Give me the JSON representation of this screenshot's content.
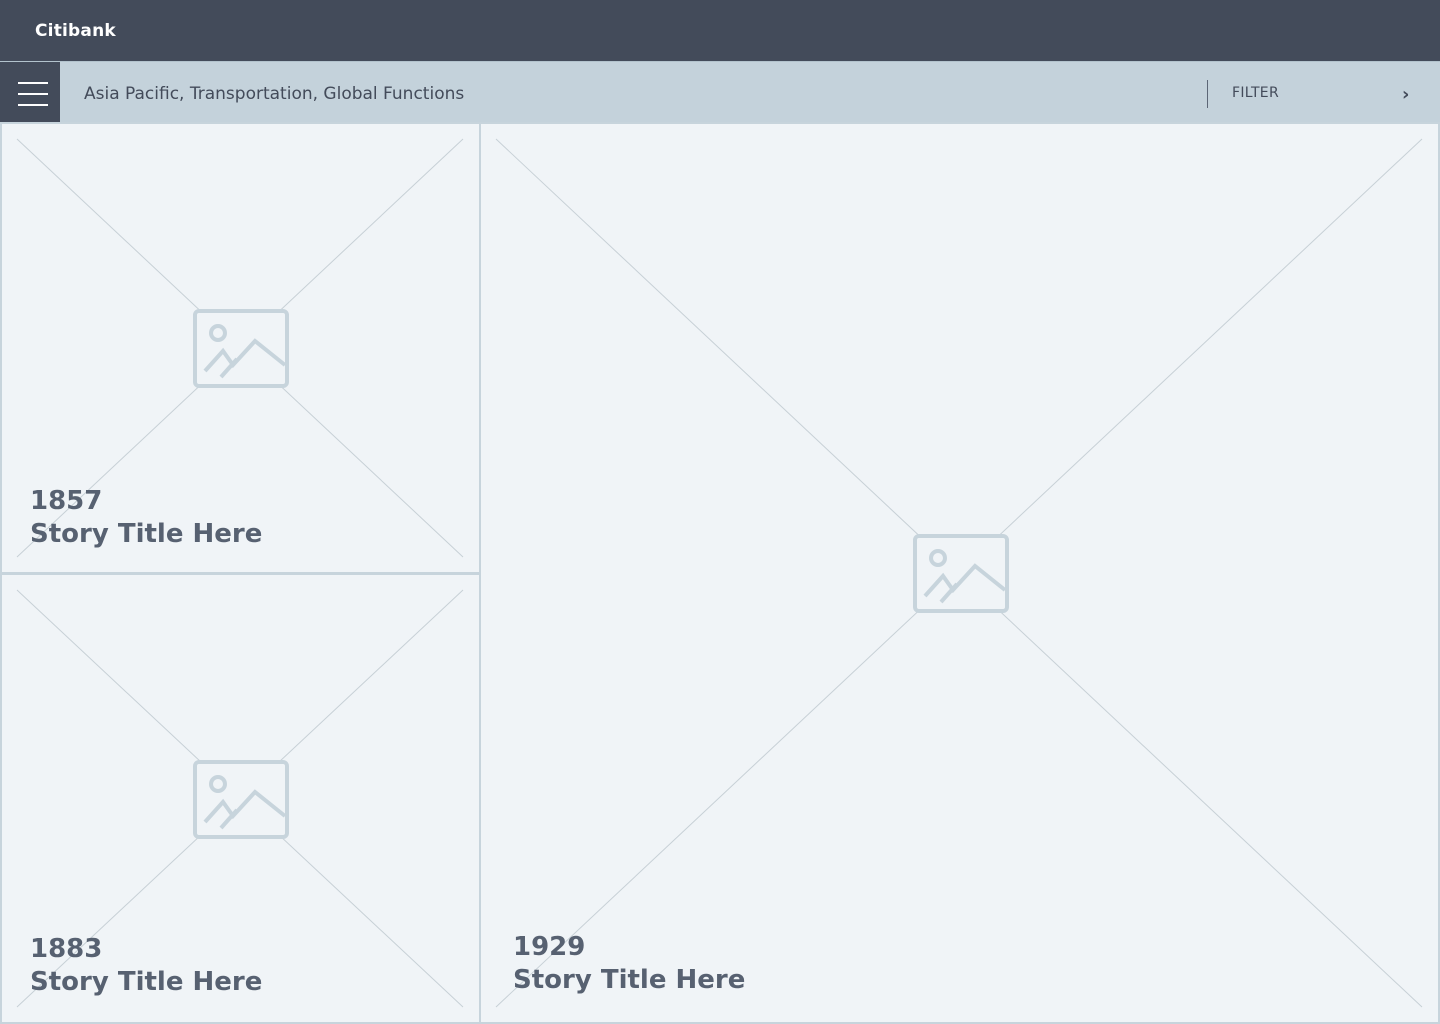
{
  "app": {
    "brand": "Citibank"
  },
  "filterbar": {
    "breadcrumb": "Asia Pacific, Transportation, Global Functions",
    "filter_label": "FILTER",
    "chevron": "›"
  },
  "stories": [
    {
      "year": "1857",
      "title": "Story Title Here"
    },
    {
      "year": "1883",
      "title": "Story Title Here"
    },
    {
      "year": "1929",
      "title": "Story Title Here"
    }
  ],
  "icons": {
    "menu": "hamburger-menu-icon",
    "filter_arrow": "chevron-right-icon",
    "placeholder": "image-placeholder-icon"
  },
  "colors": {
    "topbar": "#434b5a",
    "filterbar": "#c4d2db",
    "card_bg": "#f0f4f7",
    "card_border": "#c7d4dc",
    "text": "#576171"
  }
}
